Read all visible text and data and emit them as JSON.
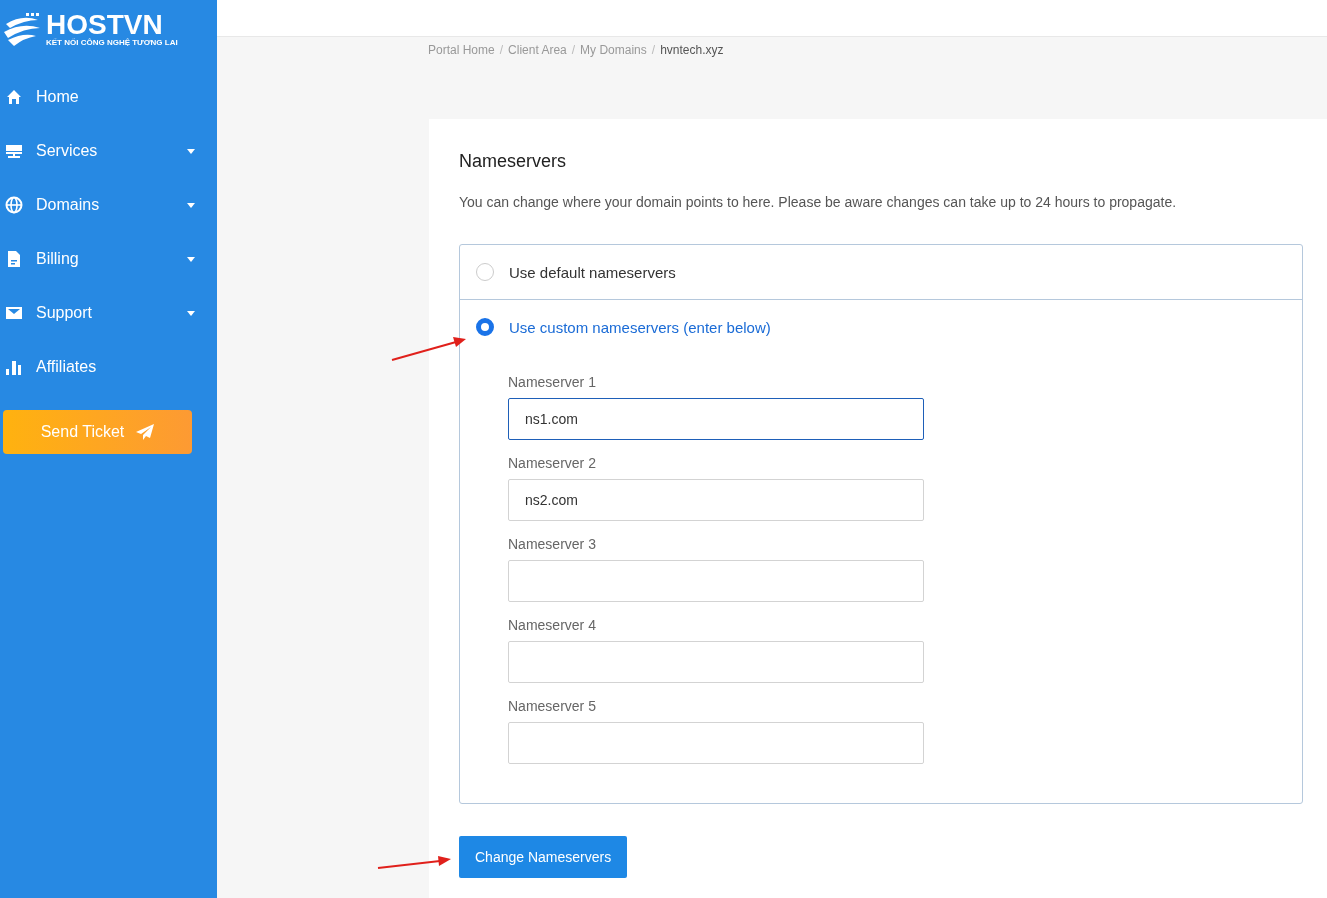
{
  "sidebar": {
    "logo": {
      "name": "HOSTVN",
      "tagline": "KẾT NỐI CÔNG NGHỆ TƯƠNG LAI"
    },
    "items": [
      {
        "label": "Home",
        "has_dropdown": false
      },
      {
        "label": "Services",
        "has_dropdown": true
      },
      {
        "label": "Domains",
        "has_dropdown": true
      },
      {
        "label": "Billing",
        "has_dropdown": true
      },
      {
        "label": "Support",
        "has_dropdown": true
      },
      {
        "label": "Affiliates",
        "has_dropdown": false
      }
    ],
    "send_ticket": "Send Ticket"
  },
  "breadcrumb": {
    "separator": "/",
    "items": [
      "Portal Home",
      "Client Area",
      "My Domains",
      "hvntech.xyz"
    ]
  },
  "card": {
    "title": "Nameservers",
    "description": "You can change where your domain points to here. Please be aware changes can take up to 24 hours to propagate.",
    "options": [
      {
        "label": "Use default nameservers",
        "selected": false
      },
      {
        "label": "Use custom nameservers (enter below)",
        "selected": true
      }
    ],
    "fields": [
      {
        "label": "Nameserver 1",
        "value": "ns1.com",
        "focused": true
      },
      {
        "label": "Nameserver 2",
        "value": "ns2.com",
        "focused": false
      },
      {
        "label": "Nameserver 3",
        "focused": false
      },
      {
        "label": "Nameserver 4",
        "focused": false
      },
      {
        "label": "Nameserver 5",
        "focused": false
      }
    ],
    "submit": "Change Nameservers"
  }
}
